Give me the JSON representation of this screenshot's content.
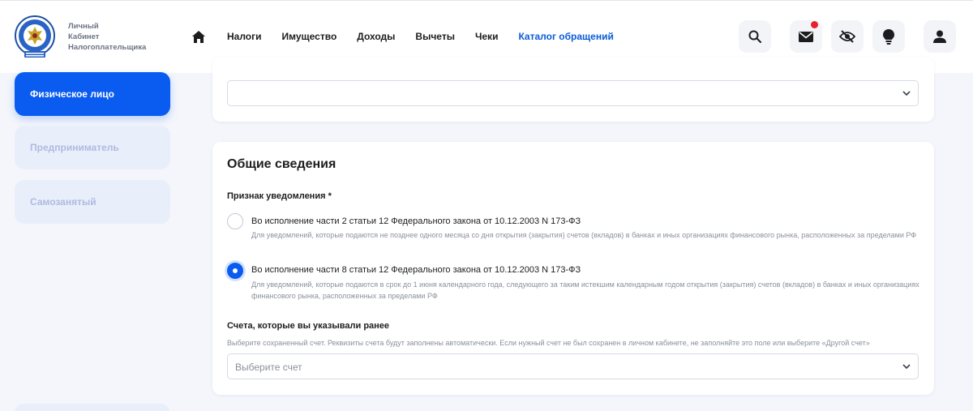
{
  "header": {
    "logo_lines": [
      "Личный",
      "Кабинет",
      "Налогоплательщика"
    ],
    "nav": [
      "Налоги",
      "Имущество",
      "Доходы",
      "Вычеты",
      "Чеки",
      "Каталог обращений"
    ],
    "active_nav": "Каталог обращений",
    "icons": [
      "search-icon",
      "mail-icon",
      "eye-off-icon",
      "lightbulb-icon",
      "user-icon"
    ],
    "has_notification": true
  },
  "sidebar": {
    "items": [
      "Физическое лицо",
      "Предприниматель",
      "Самозанятый"
    ],
    "active": "Физическое лицо"
  },
  "general": {
    "title": "Общие сведения",
    "notice_label": "Признак уведомления *",
    "options": [
      {
        "title": "Во исполнение части 2 статьи 12 Федерального закона от 10.12.2003 N 173-ФЗ",
        "description": "Для уведомлений, которые подаются не позднее одного месяца со дня открытия (закрытия) счетов (вкладов) в банках и иных организациях финансового рынка, расположенных за пределами РФ",
        "selected": false
      },
      {
        "title": "Во исполнение части 8 статьи 12 Федерального закона от 10.12.2003 N 173-ФЗ",
        "description": "Для уведомлений, которые подаются в срок до 1 июня календарного года, следующего за таким истекшим календарным годом открытия (закрытия) счетов (вкладов) в банках и иных организациях финансового рынка, расположенных за пределами РФ",
        "selected": true
      }
    ],
    "accounts_label": "Счета, которые вы указывали ранее",
    "accounts_hint": "Выберите сохраненный счет. Реквизиты счета будут заполнены автоматически. Если нужный счет не был сохранен в личном кабинете, не заполняйте это поле или выберите «Другой счет»",
    "accounts_placeholder": "Выберите счет"
  },
  "colors": {
    "accent": "#0a5bf0",
    "notification": "#e8212e"
  }
}
